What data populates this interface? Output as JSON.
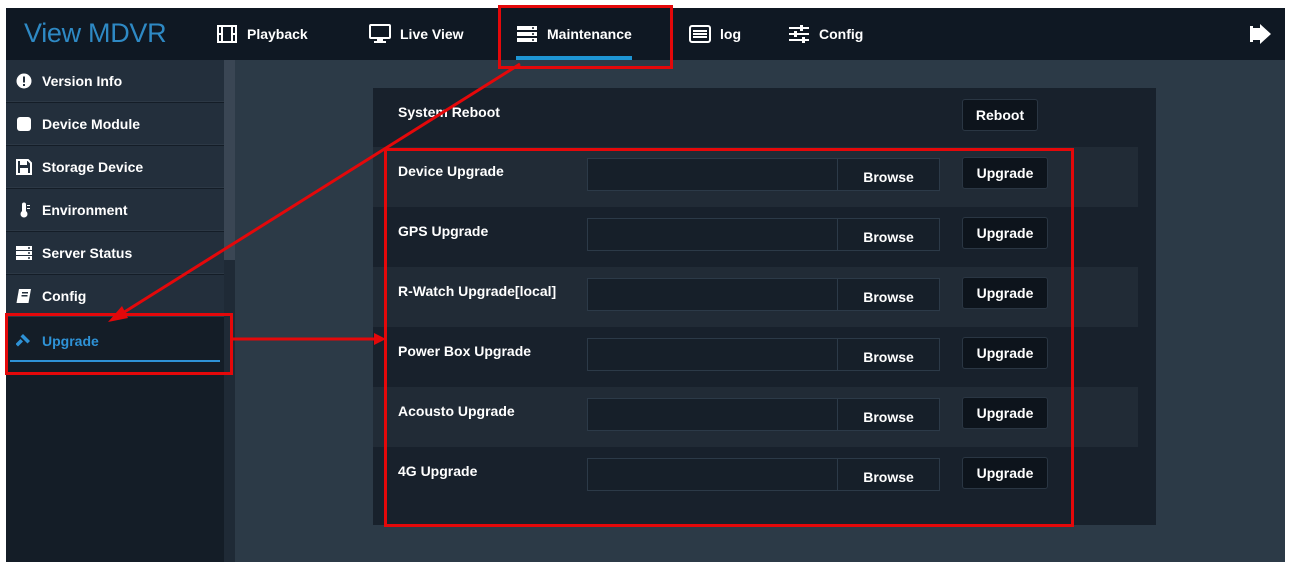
{
  "app": {
    "brand": "View MDVR"
  },
  "nav": [
    {
      "label": "Playback",
      "icon": "film-icon"
    },
    {
      "label": "Live View",
      "icon": "monitor-icon"
    },
    {
      "label": "Maintenance",
      "icon": "server-icon",
      "active": true
    },
    {
      "label": "log",
      "icon": "list-icon"
    },
    {
      "label": "Config",
      "icon": "sliders-icon"
    }
  ],
  "header": {
    "logout_icon": "sign-out-icon"
  },
  "sidebar": {
    "items": [
      {
        "label": "Version Info",
        "icon": "info-circle-icon"
      },
      {
        "label": "Device Module",
        "icon": "square-icon"
      },
      {
        "label": "Storage Device",
        "icon": "floppy-disk-icon"
      },
      {
        "label": "Environment",
        "icon": "thermometer-icon"
      },
      {
        "label": "Server Status",
        "icon": "server-icon"
      },
      {
        "label": "Config",
        "icon": "book-icon"
      },
      {
        "label": "Upgrade",
        "icon": "gavel-icon",
        "active": true
      }
    ]
  },
  "main": {
    "reboot": {
      "label": "System Reboot",
      "button": "Reboot"
    },
    "upgrades": [
      {
        "label": "Device Upgrade",
        "browse": "Browse",
        "button": "Upgrade"
      },
      {
        "label": "GPS Upgrade",
        "browse": "Browse",
        "button": "Upgrade"
      },
      {
        "label": "R-Watch Upgrade[local]",
        "browse": "Browse",
        "button": "Upgrade"
      },
      {
        "label": "Power Box Upgrade",
        "browse": "Browse",
        "button": "Upgrade"
      },
      {
        "label": "Acousto Upgrade",
        "browse": "Browse",
        "button": "Upgrade"
      },
      {
        "label": "4G Upgrade",
        "browse": "Browse",
        "button": "Upgrade"
      }
    ]
  },
  "colors": {
    "brand": "#2e89c4",
    "active_accent": "#1e95d4",
    "annotation": "#e4080a",
    "topbar_bg": "#0f1823",
    "page_bg": "#2c3a47"
  }
}
